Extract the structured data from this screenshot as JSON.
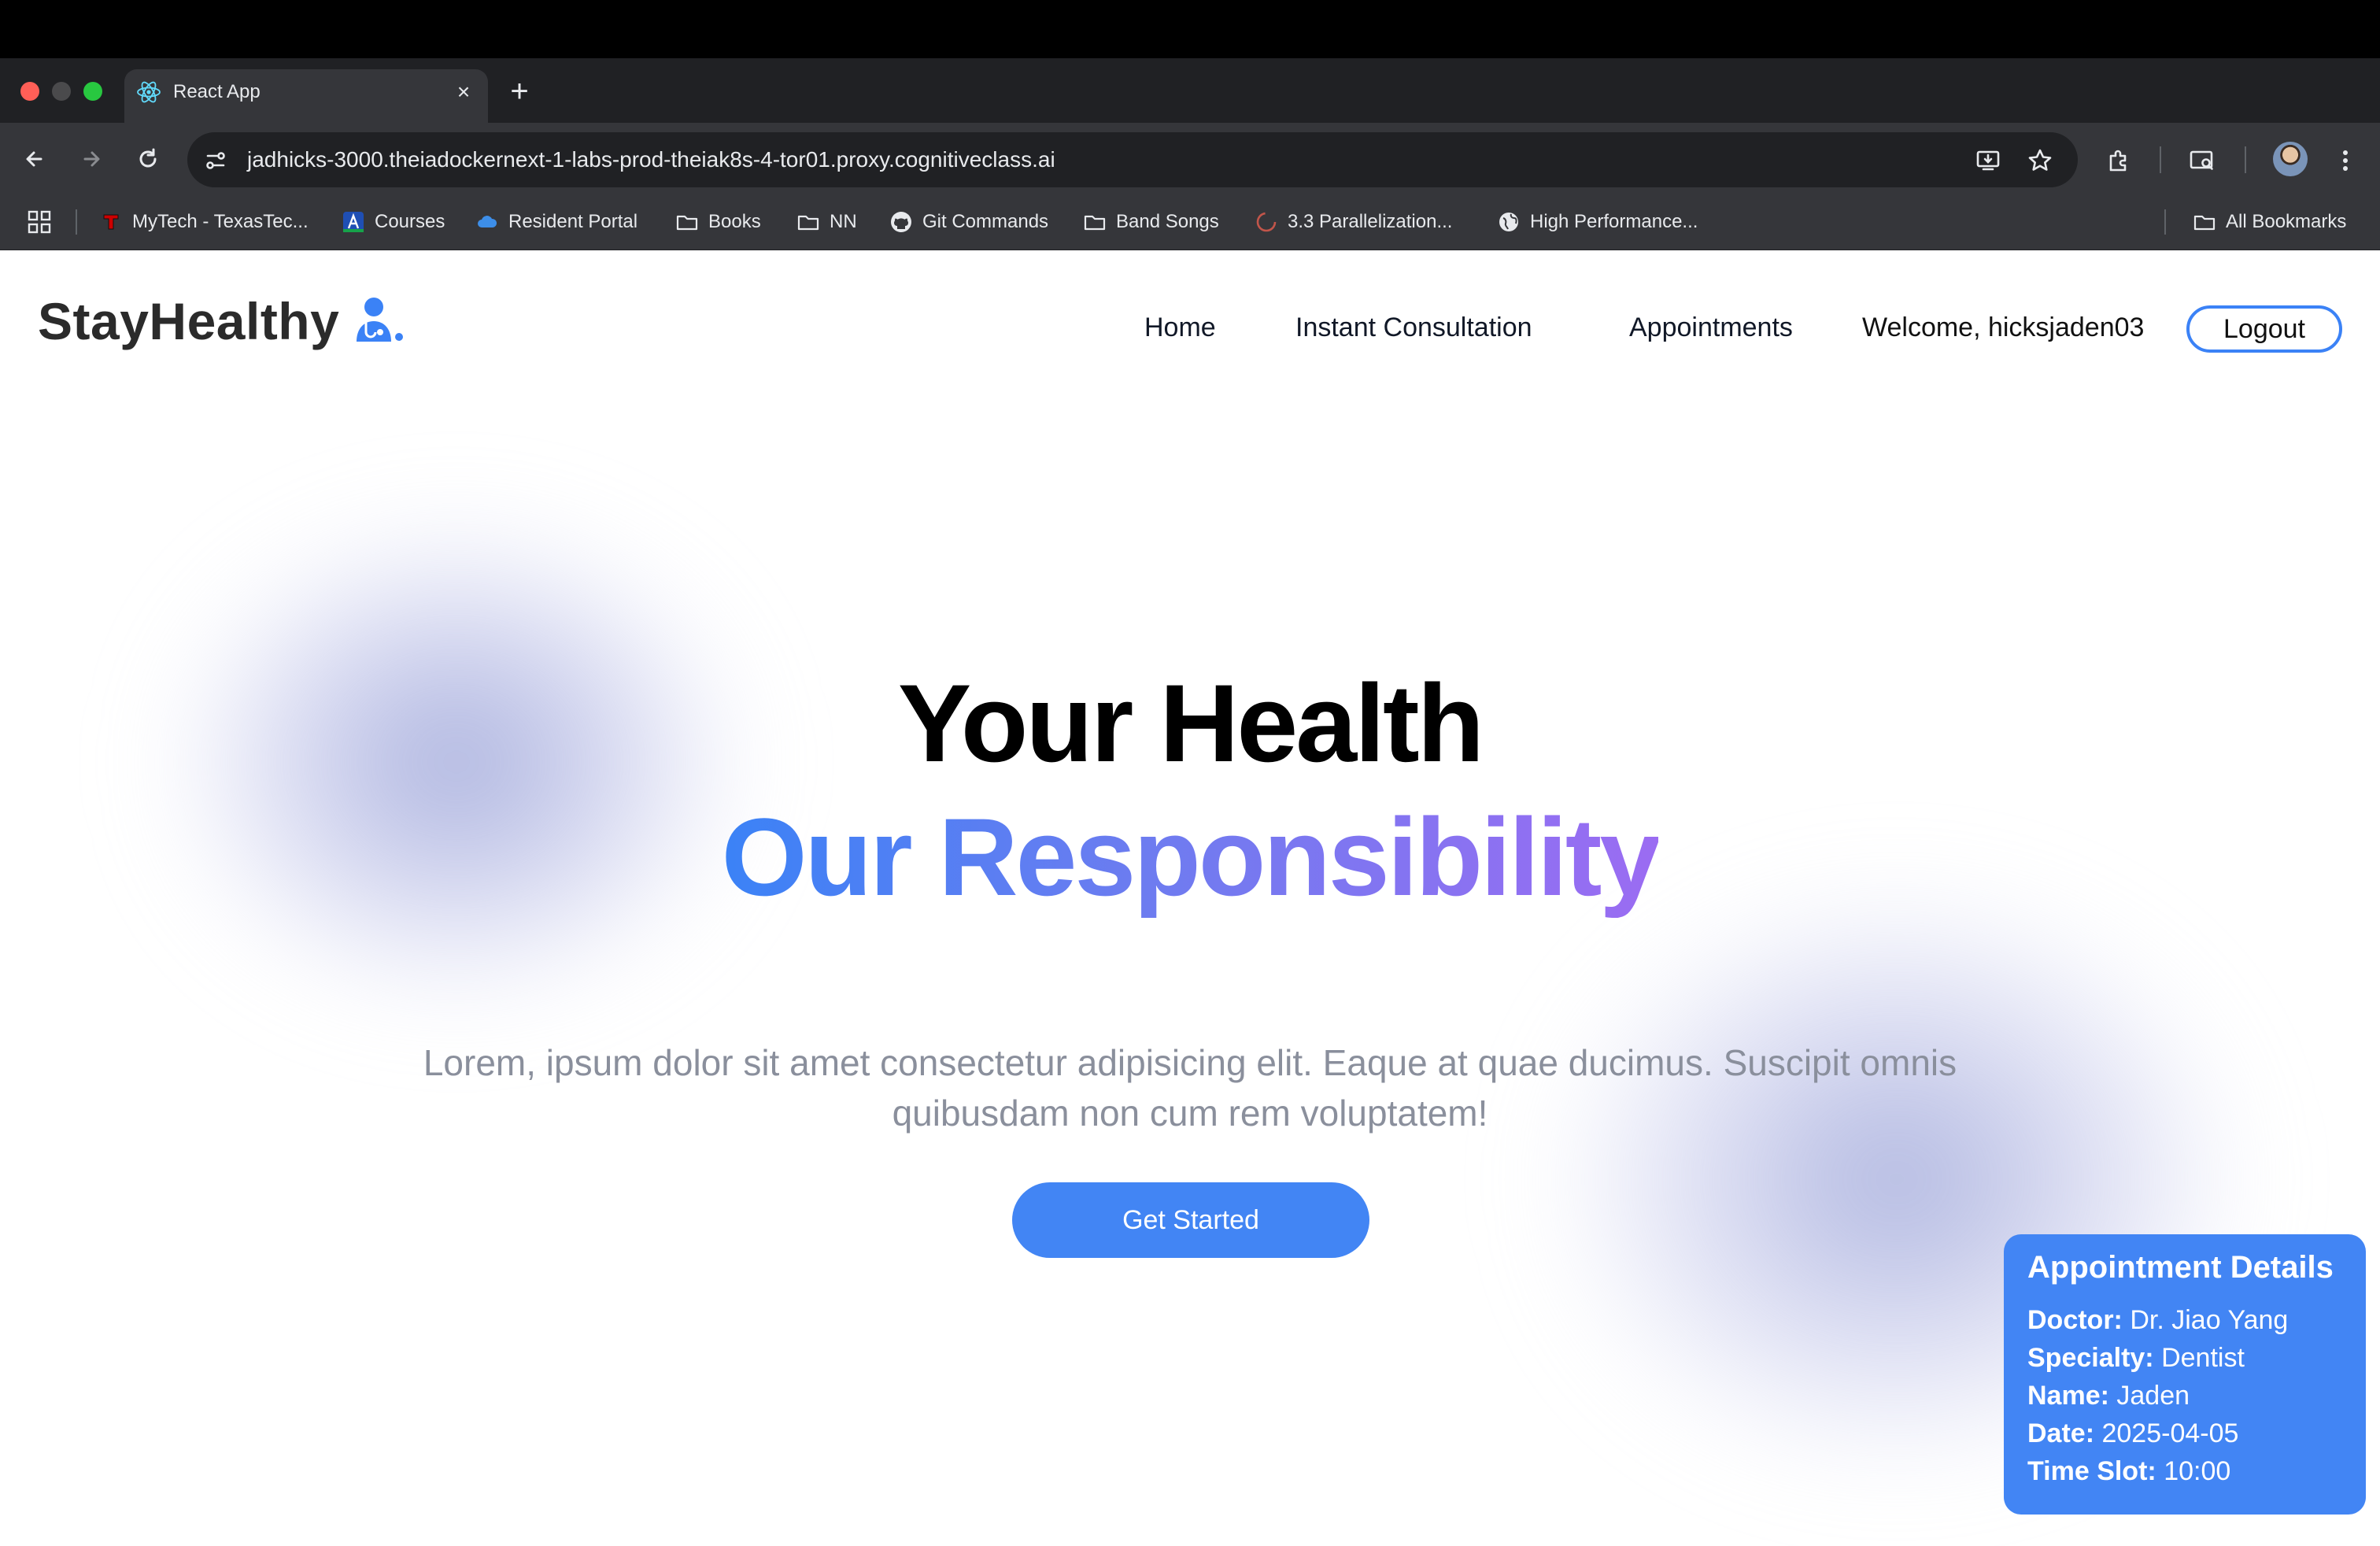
{
  "browser": {
    "tab_title": "React App",
    "tab_close": "×",
    "new_tab": "+",
    "url": "jadhicks-3000.theiadockernext-1-labs-prod-theiak8s-4-tor01.proxy.cognitiveclass.ai",
    "bookmarks": [
      {
        "label": "MyTech - TexasTec...",
        "icon": "texas-tech-icon"
      },
      {
        "label": "Courses",
        "icon": "courses-icon"
      },
      {
        "label": "Resident Portal",
        "icon": "cloud-icon"
      },
      {
        "label": "Books",
        "icon": "folder-icon"
      },
      {
        "label": "NN",
        "icon": "folder-icon"
      },
      {
        "label": "Git Commands",
        "icon": "github-icon"
      },
      {
        "label": "Band Songs",
        "icon": "folder-icon"
      },
      {
        "label": "3.3 Parallelization...",
        "icon": "loading-icon"
      },
      {
        "label": "High Performance...",
        "icon": "globe-icon"
      }
    ],
    "all_bookmarks": "All Bookmarks"
  },
  "site": {
    "logo": "StayHealthy",
    "nav": {
      "home": "Home",
      "instant_consultation": "Instant Consultation",
      "appointments": "Appointments"
    },
    "welcome": "Welcome, hicksjaden03",
    "logout": "Logout"
  },
  "hero": {
    "line1": "Your Health",
    "line2": "Our Responsibility",
    "lead": "Lorem, ipsum dolor sit amet consectetur adipisicing elit. Eaque at quae ducimus. Suscipit omnis quibusdam non cum rem voluptatem!",
    "cta": "Get Started"
  },
  "appointment": {
    "title": "Appointment Details",
    "doctor_label": "Doctor:",
    "doctor": "Dr. Jiao Yang",
    "specialty_label": "Specialty:",
    "specialty": "Dentist",
    "name_label": "Name:",
    "name": "Jaden",
    "date_label": "Date:",
    "date": "2025-04-05",
    "time_label": "Time Slot:",
    "time": "10:00"
  },
  "colors": {
    "accent": "#4285f4",
    "gradient_start": "#3b82f6",
    "gradient_end": "#9b6cf2"
  }
}
